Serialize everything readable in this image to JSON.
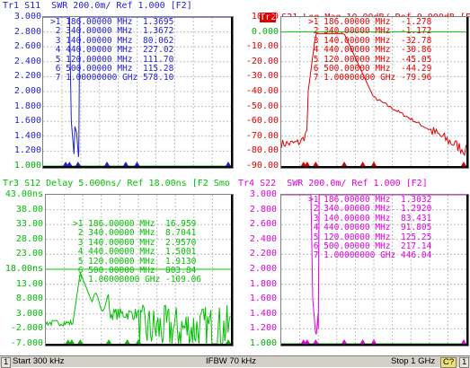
{
  "colors": {
    "tr1": "#0000ff",
    "tr2": "#ff0000",
    "tr3": "#00cc00",
    "tr4": "#ff00ff",
    "grid": "#bdbdbd",
    "ref": "#00ff00"
  },
  "traces": [
    {
      "id": "tr1",
      "color": "#1f1fd0",
      "title": "Tr1 S11  SWR 200.0m/ Ref 1.000 [F2]",
      "axis": [
        "3.000",
        "2.800",
        "2.600",
        "2.400",
        "2.200",
        "2.000",
        "1.800",
        "1.600",
        "1.400",
        "1.200",
        "1.000"
      ],
      "ref_row": 10,
      "markers": [
        {
          "n": ">1",
          "f": "186.00000 MHz",
          "v": "1.3695"
        },
        {
          "n": "2",
          "f": "340.00000 MHz",
          "v": "1.3672"
        },
        {
          "n": "3",
          "f": "140.00000 MHz",
          "v": "80.062"
        },
        {
          "n": "4",
          "f": "440.00000 MHz",
          "v": "227.02"
        },
        {
          "n": "5",
          "f": "120.00000 MHz",
          "v": "111.70"
        },
        {
          "n": "6",
          "f": "500.00000 MHz",
          "v": "115.28"
        },
        {
          "n": "7",
          "f": "1.00000000 GHz",
          "v": "578.10"
        }
      ]
    },
    {
      "id": "tr2",
      "color": "#e00000",
      "title": "Tr2 S21 Log Mag 10.00dB/ Ref 0.000dB [F2]",
      "title_box": "Tr2",
      "axis": [
        "10.00",
        "0.000",
        "-10.00",
        "-20.00",
        "-30.00",
        "-40.00",
        "-50.00",
        "-60.00",
        "-70.00",
        "-80.00",
        "-90.00"
      ],
      "ref_row": 1,
      "markers": [
        {
          "n": ">1",
          "f": "186.00000 MHz",
          "v": "-1.278"
        },
        {
          "n": "2",
          "f": "340.00000 MHz",
          "v": "-1.172"
        },
        {
          "n": "3",
          "f": "140.00000 MHz",
          "v": "-32.78"
        },
        {
          "n": "4",
          "f": "440.00000 MHz",
          "v": "-30.86"
        },
        {
          "n": "5",
          "f": "120.00000 MHz",
          "v": "-45.05"
        },
        {
          "n": "6",
          "f": "500.00000 MHz",
          "v": "-44.29"
        },
        {
          "n": "7",
          "f": "1.00000000 GHz",
          "v": "-79.96"
        }
      ]
    },
    {
      "id": "tr3",
      "color": "#00c000",
      "title": "Tr3 S12 Delay 5.000ns/ Ref 18.00ns [F2 Smo",
      "axis": [
        "43.00ns",
        "38.00",
        "33.00",
        "28.00",
        "23.00",
        "18.00ns",
        "13.00",
        "8.000",
        "3.000",
        "-2.000",
        "-7.000"
      ],
      "ref_row": 5,
      "markers": [
        {
          "n": ">1",
          "f": "186.00000 MHz",
          "v": "16.959"
        },
        {
          "n": "2",
          "f": "340.00000 MHz",
          "v": "8.7041"
        },
        {
          "n": "3",
          "f": "140.00000 MHz",
          "v": "2.9570"
        },
        {
          "n": "4",
          "f": "440.00000 MHz",
          "v": "1.5001"
        },
        {
          "n": "5",
          "f": "120.00000 MHz",
          "v": "1.9130"
        },
        {
          "n": "6",
          "f": "500.00000 MHz",
          "v": "803.84"
        },
        {
          "n": "7",
          "f": "1.00000000 GHz",
          "v": "-109.06"
        }
      ]
    },
    {
      "id": "tr4",
      "color": "#e000e0",
      "title": "Tr4 S22  SWR 200.0m/ Ref 1.000 [F2]",
      "axis": [
        "3.000",
        "2.800",
        "2.600",
        "2.400",
        "2.200",
        "2.000",
        "1.800",
        "1.600",
        "1.400",
        "1.200",
        "1.000"
      ],
      "ref_row": 10,
      "markers": [
        {
          "n": ">1",
          "f": "186.00000 MHz",
          "v": "1.3032"
        },
        {
          "n": "2",
          "f": "340.00000 MHz",
          "v": "1.2920"
        },
        {
          "n": "3",
          "f": "140.00000 MHz",
          "v": "83.431"
        },
        {
          "n": "4",
          "f": "440.00000 MHz",
          "v": "91.805"
        },
        {
          "n": "5",
          "f": "120.00000 MHz",
          "v": "125.25"
        },
        {
          "n": "6",
          "f": "500.00000 MHz",
          "v": "217.14"
        },
        {
          "n": "7",
          "f": "1.00000000 GHz",
          "v": "446.04"
        }
      ]
    }
  ],
  "status": {
    "channel": "1",
    "start": "Start 300 kHz",
    "ifbw": "IFBW 70 kHz",
    "stop": "Stop 1 GHz",
    "cal": "C?",
    "box": "1"
  }
}
